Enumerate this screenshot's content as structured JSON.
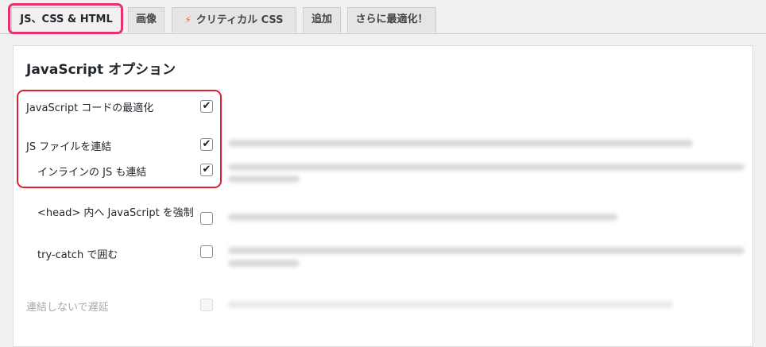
{
  "tabs": [
    {
      "label": "JS、CSS & HTML",
      "active": true
    },
    {
      "label": "画像",
      "active": false
    },
    {
      "label": "クリティカル CSS",
      "icon": "lightning-icon",
      "active": false
    },
    {
      "label": "追加",
      "active": false
    },
    {
      "label": "さらに最適化！",
      "active": false
    }
  ],
  "section": {
    "title": "JavaScript オプション"
  },
  "options": [
    {
      "label": "JavaScript コードの最適化",
      "checked": true
    },
    {
      "label": "JS ファイルを連結",
      "checked": true
    },
    {
      "label": "インラインの JS も連結",
      "checked": true
    },
    {
      "label": "<head> 内へ JavaScript を強制",
      "checked": false
    },
    {
      "label": "try-catch で囲む",
      "checked": false
    },
    {
      "label": "連結しないで遅延",
      "checked": false,
      "disabled": true
    }
  ],
  "checkmark_glyph": "✔",
  "colors": {
    "tab_highlight": "#e8306c",
    "options_highlight": "#e0202e",
    "bolt": "#e36c2f"
  }
}
